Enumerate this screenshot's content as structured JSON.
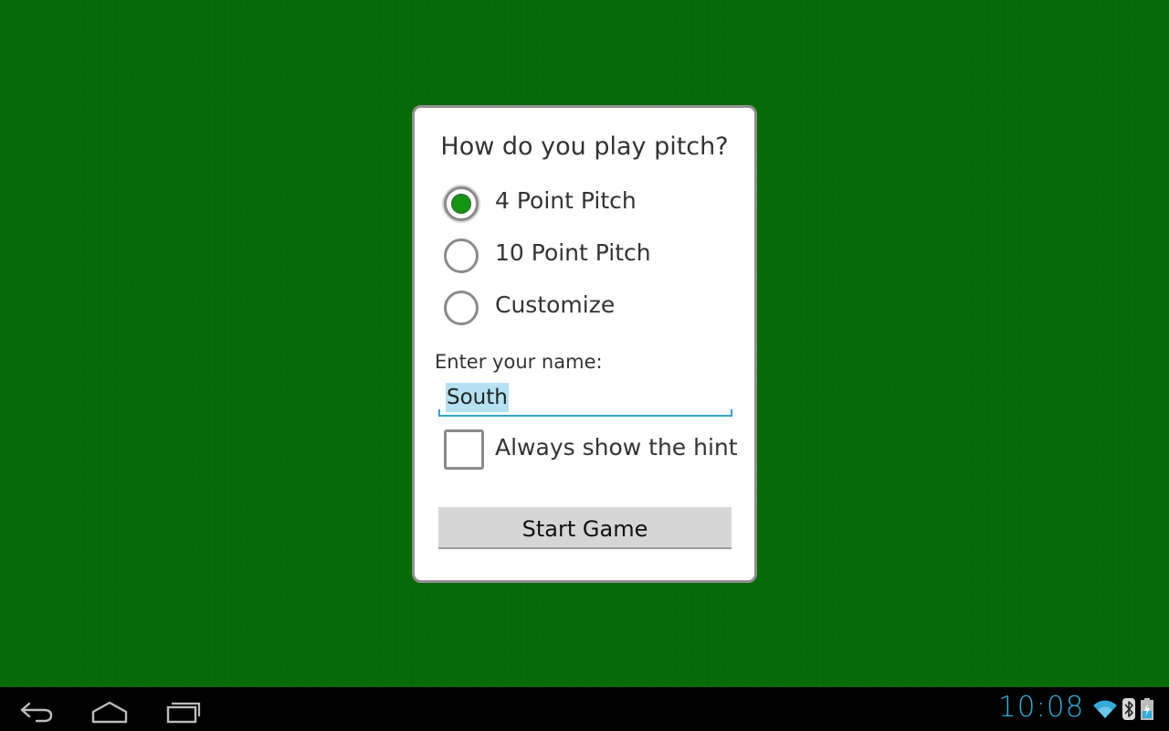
{
  "dialog": {
    "title": "How do you play pitch?",
    "options": [
      {
        "label": "4 Point Pitch",
        "checked": true
      },
      {
        "label": "10 Point Pitch",
        "checked": false
      },
      {
        "label": "Customize",
        "checked": false
      }
    ],
    "name_label": "Enter your name:",
    "name_value": "South",
    "hint_label": "Always show the hint",
    "hint_checked": false,
    "start_label": "Start Game"
  },
  "status_bar": {
    "time": "10:08",
    "icons": [
      "wifi-icon",
      "bluetooth-icon",
      "battery-charging-icon"
    ]
  },
  "navigation": {
    "icons": [
      "back-icon",
      "home-icon",
      "recent-apps-icon"
    ]
  },
  "colors": {
    "felt": "#056b05",
    "radio_selected": "#149614",
    "accent": "#33a3c8",
    "text_selection": "#b6e1f3",
    "clock": "#35a9d8"
  }
}
